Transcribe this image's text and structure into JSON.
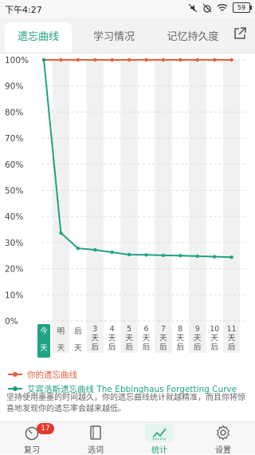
{
  "status_bar": {
    "time": "下午4:27",
    "battery": "59",
    "icons": [
      "silent-icon",
      "alarm-icon",
      "wifi-icon"
    ]
  },
  "tabs": [
    {
      "label": "遗忘曲线",
      "active": true
    },
    {
      "label": "学习情况",
      "active": false
    },
    {
      "label": "记忆持久度",
      "active": false
    }
  ],
  "chart_data": {
    "type": "line",
    "ylim": [
      0,
      100
    ],
    "y_ticks": [
      "100%",
      "90%",
      "80%",
      "70%",
      "60%",
      "50%",
      "40%",
      "30%",
      "20%",
      "10%",
      "0%"
    ],
    "x_labels": [
      "今天",
      "明天",
      "后天",
      "3天后",
      "4天后",
      "5天后",
      "6天后",
      "7天后",
      "8天后",
      "9天后",
      "10天后",
      "11天后"
    ],
    "highlight_x": 0,
    "series": [
      {
        "name": "你的遗忘曲线",
        "color": "#e0603c",
        "values": [
          100,
          100,
          100,
          100,
          100,
          100,
          100,
          100,
          100,
          100,
          100,
          100
        ]
      },
      {
        "name": "艾宾浩斯遗忘曲线 The Ebbinghaus Forgetting Curve",
        "color": "#1fa383",
        "values": [
          100,
          33.7,
          27.8,
          27.2,
          26.3,
          25.4,
          25.3,
          25.1,
          25.0,
          24.8,
          24.6,
          24.4
        ]
      }
    ]
  },
  "legend": [
    {
      "label": "你的遗忘曲线",
      "color": "#e0603c"
    },
    {
      "label": "艾宾浩斯遗忘曲线 The Ebbinghaus Forgetting Curve",
      "color": "#1fa383"
    }
  ],
  "description": "坚持使用墨墨的时间越久，你的遗忘曲线统计就越精准，而且你将惊喜地发现你的遗忘率会越来越低。",
  "bottom_nav": [
    {
      "label": "复习",
      "icon": "review-clock-icon",
      "badge": "17",
      "active": false
    },
    {
      "label": "选词",
      "icon": "book-icon",
      "active": false
    },
    {
      "label": "统计",
      "icon": "stats-chart-icon",
      "active": true
    },
    {
      "label": "设置",
      "icon": "gear-icon",
      "active": false
    }
  ]
}
